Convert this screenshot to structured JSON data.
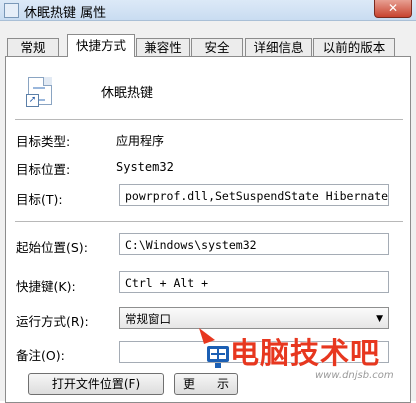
{
  "window": {
    "title": "休眠热键 属性",
    "close_label": "✕"
  },
  "tabs": [
    {
      "label": "常规",
      "active": false
    },
    {
      "label": "快捷方式",
      "active": true
    },
    {
      "label": "兼容性",
      "active": false
    },
    {
      "label": "安全",
      "active": false
    },
    {
      "label": "详细信息",
      "active": false
    },
    {
      "label": "以前的版本",
      "active": false
    }
  ],
  "shortcut": {
    "name": "休眠热键",
    "target_type_label": "目标类型:",
    "target_type_value": "应用程序",
    "target_location_label": "目标位置:",
    "target_location_value": "System32",
    "target_label": "目标(T):",
    "target_value": "powrprof.dll,SetSuspendState Hibernate",
    "start_in_label": "起始位置(S):",
    "start_in_value": "C:\\Windows\\system32",
    "hotkey_label": "快捷键(K):",
    "hotkey_value": "Ctrl + Alt +",
    "run_label": "运行方式(R):",
    "run_value": "常规窗口",
    "comment_label": "备注(O):",
    "comment_value": ""
  },
  "buttons": {
    "open_location": "打开文件位置(F)",
    "change_icon_partial": "更",
    "change_icon_partial2": "示"
  },
  "watermark": {
    "text": "电脑技术吧",
    "url": "www.dnjsb.com"
  },
  "colors": {
    "watermark_red": "#e7371f",
    "watermark_blue": "#1b5fb4",
    "close_red": "#c7432f"
  }
}
